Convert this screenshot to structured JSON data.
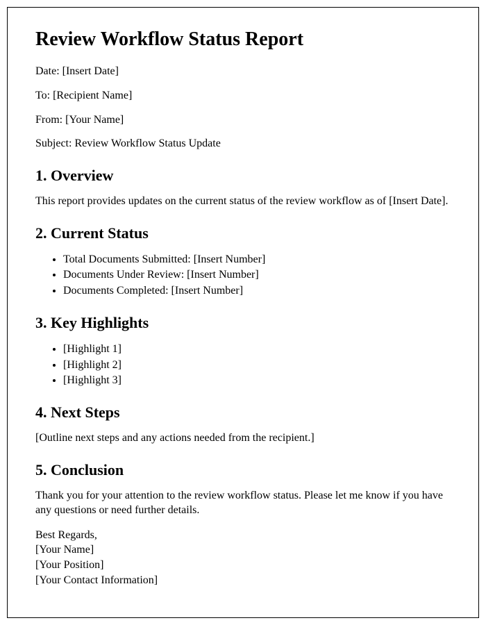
{
  "title": "Review Workflow Status Report",
  "meta": {
    "date": "Date: [Insert Date]",
    "to": "To: [Recipient Name]",
    "from": "From: [Your Name]",
    "subject": "Subject: Review Workflow Status Update"
  },
  "sections": {
    "overview": {
      "heading": "1. Overview",
      "body": "This report provides updates on the current status of the review workflow as of [Insert Date]."
    },
    "current_status": {
      "heading": "2. Current Status",
      "items": [
        "Total Documents Submitted: [Insert Number]",
        "Documents Under Review: [Insert Number]",
        "Documents Completed: [Insert Number]"
      ]
    },
    "highlights": {
      "heading": "3. Key Highlights",
      "items": [
        "[Highlight 1]",
        "[Highlight 2]",
        "[Highlight 3]"
      ]
    },
    "next_steps": {
      "heading": "4. Next Steps",
      "body": "[Outline next steps and any actions needed from the recipient.]"
    },
    "conclusion": {
      "heading": "5. Conclusion",
      "body": "Thank you for your attention to the review workflow status. Please let me know if you have any questions or need further details."
    }
  },
  "signature": {
    "closing": "Best Regards,",
    "name": "[Your Name]",
    "position": "[Your Position]",
    "contact": "[Your Contact Information]"
  }
}
